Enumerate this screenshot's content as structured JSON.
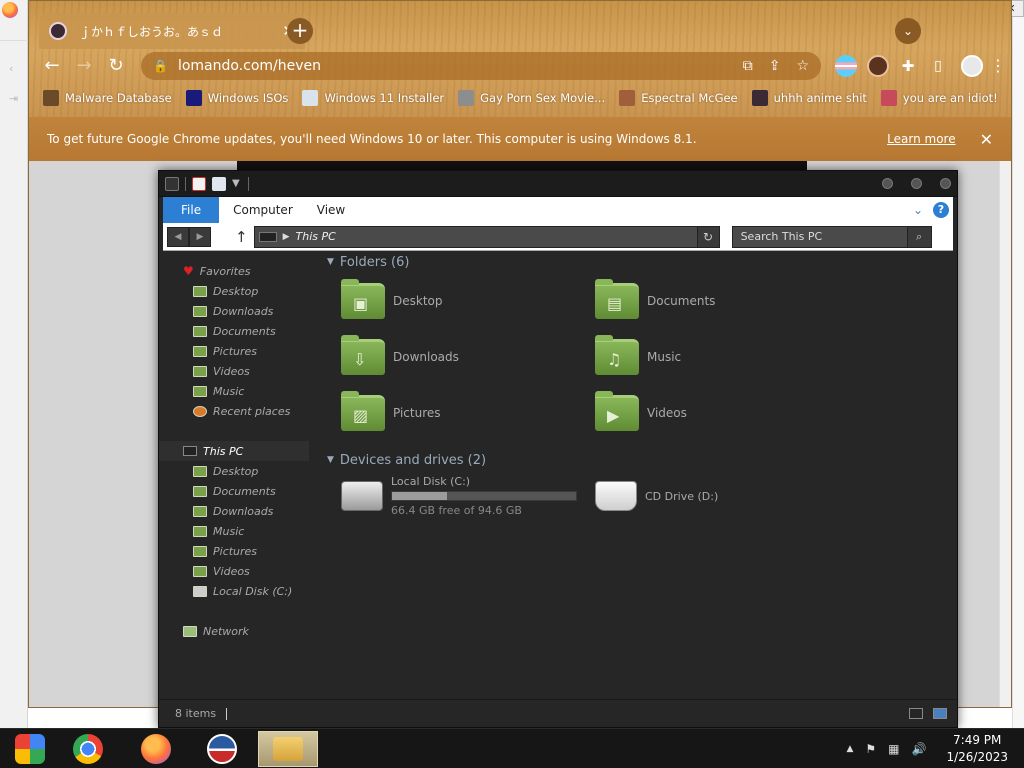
{
  "chrome": {
    "tab_title": "ｊかｈｆしおうお。あｓｄ",
    "tab_close": "✕",
    "new_tab": "+",
    "tab_search": "⌄",
    "url": "lomando.com/heven",
    "back_icon": "←",
    "forward_icon": "→",
    "reload_icon": "↻",
    "lock_icon": "🔒",
    "bookmarks": [
      {
        "label": "Malware Database",
        "color": "#6b4a2a"
      },
      {
        "label": "Windows ISOs",
        "color": "#1a1a7a"
      },
      {
        "label": "Windows 11 Installer",
        "color": "#d9e3ec"
      },
      {
        "label": "Gay Porn Sex Movie...",
        "color": "#8d8d8d"
      },
      {
        "label": "Espectral McGee",
        "color": "#a15e3a"
      },
      {
        "label": "uhhh anime shit",
        "color": "#3b2a33"
      },
      {
        "label": "you are an idiot!",
        "color": "#c64a5a"
      }
    ],
    "info_message": "To get future Google Chrome updates, you'll need Windows 10 or later. This computer is using Windows 8.1.",
    "learn_more": "Learn more",
    "info_close": "✕"
  },
  "explorer": {
    "ribbon_tabs": {
      "file": "File",
      "computer": "Computer",
      "view": "View"
    },
    "help": "?",
    "address_path": "This PC",
    "search_placeholder": "Search This PC",
    "nav": {
      "favorites": "Favorites",
      "favorites_items": [
        "Desktop",
        "Downloads",
        "Documents",
        "Pictures",
        "Videos",
        "Music",
        "Recent places"
      ],
      "this_pc": "This PC",
      "this_pc_items": [
        "Desktop",
        "Documents",
        "Downloads",
        "Music",
        "Pictures",
        "Videos",
        "Local Disk (C:)"
      ],
      "network": "Network"
    },
    "folders_group": "Folders (6)",
    "folders": [
      {
        "label": "Desktop",
        "glyph": "▣"
      },
      {
        "label": "Documents",
        "glyph": "▤"
      },
      {
        "label": "Downloads",
        "glyph": "⇩"
      },
      {
        "label": "Music",
        "glyph": "♫"
      },
      {
        "label": "Pictures",
        "glyph": "▨"
      },
      {
        "label": "Videos",
        "glyph": "▶"
      }
    ],
    "drives_group": "Devices and drives (2)",
    "drives": {
      "c_name": "Local Disk (C:)",
      "c_free": "66.4 GB free of 94.6 GB",
      "c_used_fraction": 0.298,
      "d_name": "CD Drive (D:)"
    },
    "status_items": "8 items"
  },
  "taskbar": {
    "time": "7:49 PM",
    "date": "1/26/2023",
    "tray_chevron": "▲",
    "flag_icon": "⚑",
    "net_icon": "▦",
    "volume_icon": "🔊"
  }
}
